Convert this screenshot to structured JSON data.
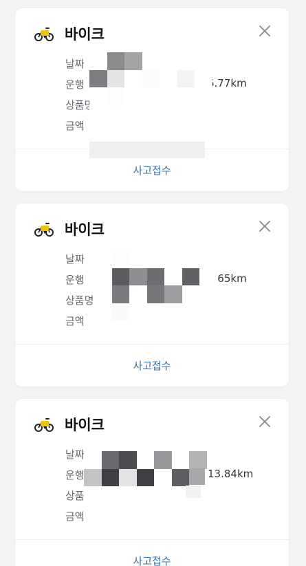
{
  "cards": [
    {
      "title": "바이크",
      "icon": "bike-icon",
      "labels": [
        "날짜",
        "운행",
        "상품명",
        "금액"
      ],
      "distance": "6.77km",
      "action_label": "사고접수"
    },
    {
      "title": "바이크",
      "icon": "bike-icon",
      "labels": [
        "날짜",
        "운행",
        "상품명",
        "금액"
      ],
      "distance": "7.65km",
      "action_label": "사고접수"
    },
    {
      "title": "바이크",
      "icon": "bike-icon",
      "labels": [
        "날짜",
        "운행",
        "상품명",
        "금액"
      ],
      "distance": "13.84km",
      "action_label": "사고접수"
    }
  ],
  "colors": {
    "accent_link": "#2f6fb3",
    "bike_yellow": "#f2c200",
    "card_bg": "#ffffff",
    "page_bg": "#f3f4f6"
  }
}
